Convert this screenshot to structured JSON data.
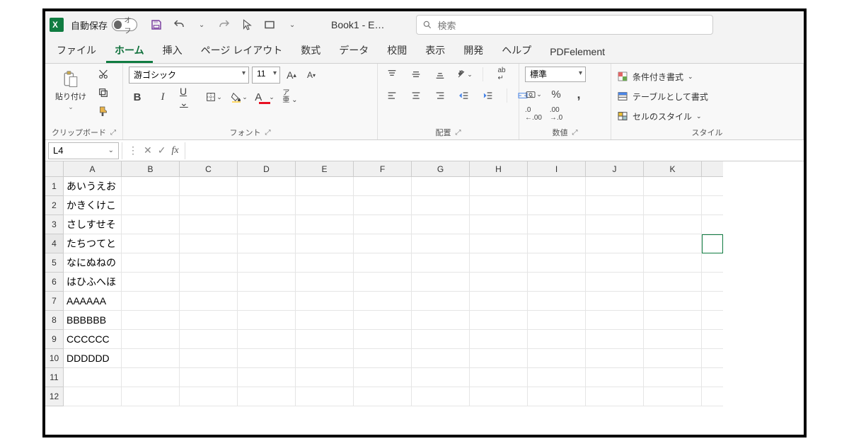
{
  "titlebar": {
    "autosave_label": "自動保存",
    "autosave_state": "オフ",
    "doc_title": "Book1  -  E…",
    "search_placeholder": "検索"
  },
  "tabs": [
    {
      "label": "ファイル",
      "id": "file"
    },
    {
      "label": "ホーム",
      "id": "home",
      "active": true
    },
    {
      "label": "挿入",
      "id": "insert"
    },
    {
      "label": "ページ レイアウト",
      "id": "layout"
    },
    {
      "label": "数式",
      "id": "formulas"
    },
    {
      "label": "データ",
      "id": "data"
    },
    {
      "label": "校閲",
      "id": "review"
    },
    {
      "label": "表示",
      "id": "view"
    },
    {
      "label": "開発",
      "id": "developer"
    },
    {
      "label": "ヘルプ",
      "id": "help"
    },
    {
      "label": "PDFelement",
      "id": "pdfelement"
    }
  ],
  "ribbon": {
    "clipboard": {
      "paste": "貼り付け",
      "label": "クリップボード"
    },
    "font": {
      "name": "游ゴシック",
      "size": "11",
      "label": "フォント"
    },
    "alignment": {
      "label": "配置"
    },
    "number": {
      "format": "標準",
      "label": "数値"
    },
    "styles": {
      "cond": "条件付き書式",
      "table": "テーブルとして書式",
      "cell": "セルのスタイル",
      "label": "スタイル"
    }
  },
  "formula_bar": {
    "name_box": "L4",
    "formula": ""
  },
  "columns": [
    "A",
    "B",
    "C",
    "D",
    "E",
    "F",
    "G",
    "H",
    "I",
    "J",
    "K"
  ],
  "rows": [
    {
      "n": 1,
      "A": "あいうえお"
    },
    {
      "n": 2,
      "A": "かきくけこ"
    },
    {
      "n": 3,
      "A": "さしすせそ"
    },
    {
      "n": 4,
      "A": "たちつてと",
      "selected": true
    },
    {
      "n": 5,
      "A": "なにぬねの"
    },
    {
      "n": 6,
      "A": "はひふへほ"
    },
    {
      "n": 7,
      "A": "AAAAAA"
    },
    {
      "n": 8,
      "A": "BBBBBB"
    },
    {
      "n": 9,
      "A": "CCCCCC"
    },
    {
      "n": 10,
      "A": "DDDDDD"
    },
    {
      "n": 11,
      "A": ""
    },
    {
      "n": 12,
      "A": ""
    }
  ],
  "selected_cell": {
    "row": 4,
    "col": "L"
  }
}
